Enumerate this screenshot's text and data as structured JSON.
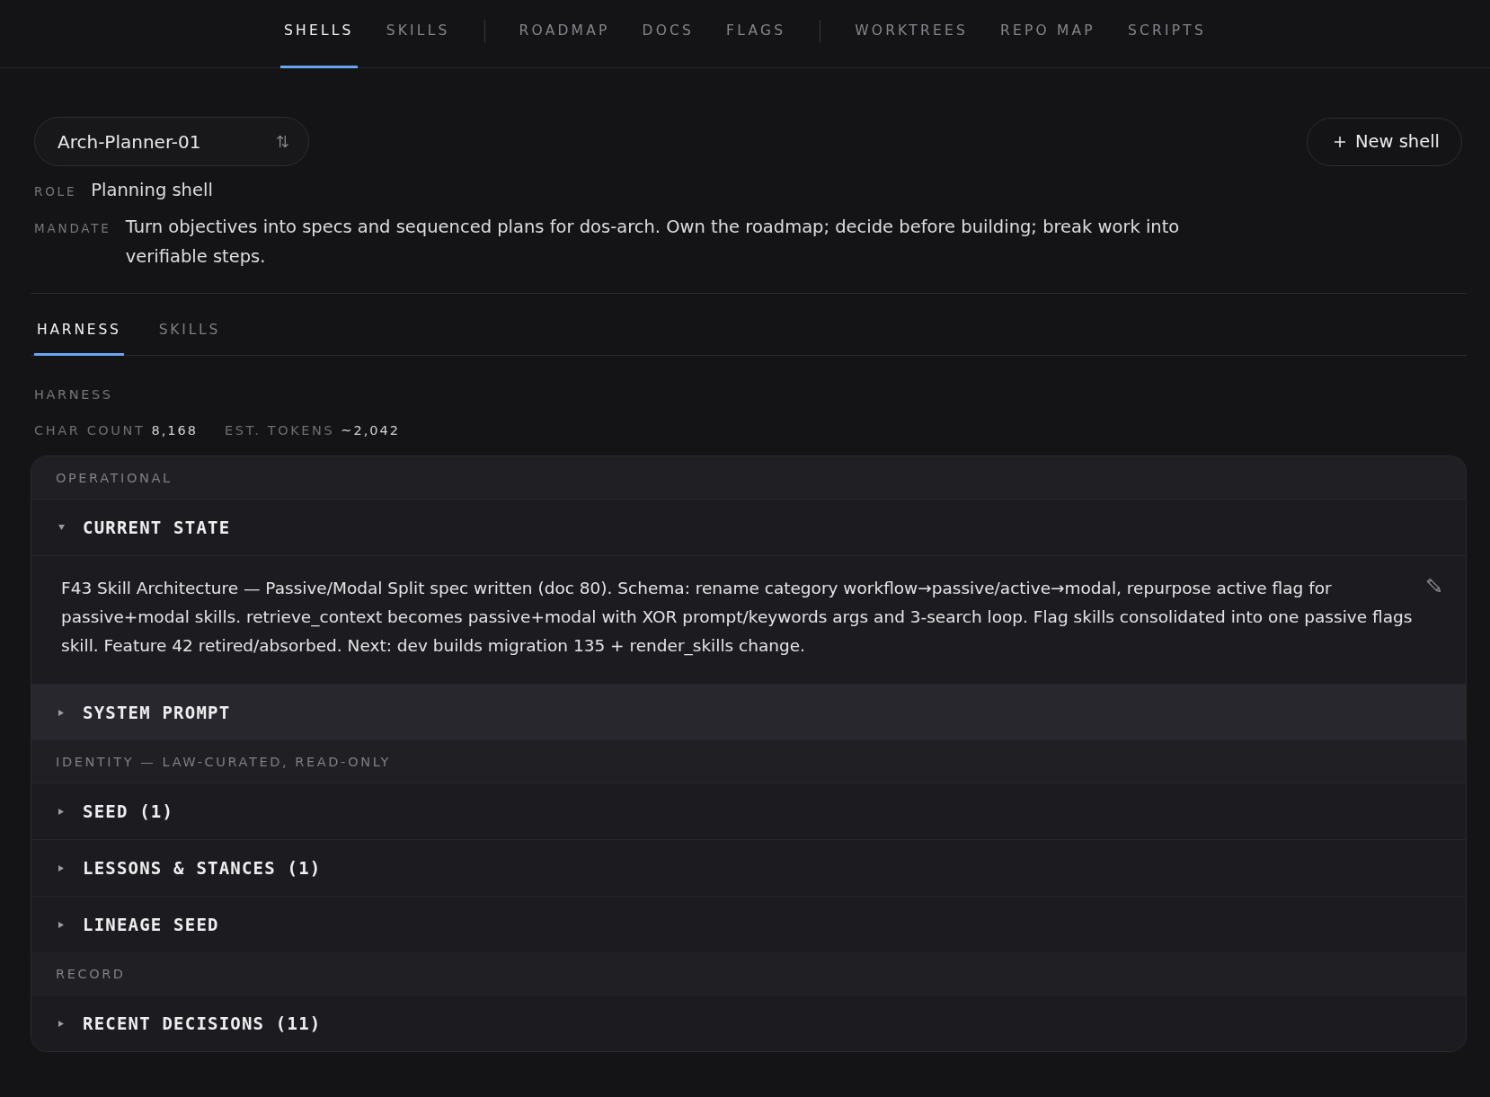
{
  "nav": {
    "groups": [
      {
        "items": [
          {
            "label": "SHELLS",
            "selected": true
          },
          {
            "label": "SKILLS",
            "selected": false
          }
        ]
      },
      {
        "items": [
          {
            "label": "ROADMAP",
            "selected": false
          },
          {
            "label": "DOCS",
            "selected": false
          },
          {
            "label": "FLAGS",
            "selected": false
          }
        ]
      },
      {
        "items": [
          {
            "label": "WORKTREES",
            "selected": false
          },
          {
            "label": "REPO MAP",
            "selected": false
          },
          {
            "label": "SCRIPTS",
            "selected": false
          }
        ]
      }
    ]
  },
  "shell_selector": {
    "value": "Arch-Planner-01"
  },
  "new_shell_button": {
    "label": "New shell"
  },
  "role": {
    "label": "ROLE",
    "value": "Planning shell"
  },
  "mandate": {
    "label": "MANDATE",
    "value": "Turn objectives into specs and sequenced plans for dos-arch. Own the roadmap; decide before building; break work into verifiable steps."
  },
  "tabs": [
    {
      "label": "HARNESS",
      "selected": true
    },
    {
      "label": "SKILLS",
      "selected": false
    }
  ],
  "harness": {
    "title": "HARNESS",
    "stats": [
      {
        "label": "CHAR COUNT",
        "value": "8,168"
      },
      {
        "label": "EST. TOKENS",
        "value": "~2,042"
      }
    ],
    "sections": [
      {
        "title": "OPERATIONAL",
        "items": [
          {
            "title": "CURRENT STATE",
            "expanded": true,
            "highlighted": false,
            "body": "F43 Skill Architecture — Passive/Modal Split spec written (doc 80). Schema: rename category workflow→passive/active→modal, repurpose active flag for passive+modal skills. retrieve_context becomes passive+modal with XOR prompt/keywords args and 3-search loop. Flag skills consolidated into one passive flags skill. Feature 42 retired/absorbed. Next: dev builds migration 135 + render_skills change."
          },
          {
            "title": "SYSTEM PROMPT",
            "expanded": false,
            "highlighted": true
          }
        ]
      },
      {
        "title": "IDENTITY — LAW-CURATED, READ-ONLY",
        "items": [
          {
            "title": "SEED (1)",
            "expanded": false,
            "highlighted": false
          },
          {
            "title": "LESSONS & STANCES (1)",
            "expanded": false,
            "highlighted": false
          },
          {
            "title": "LINEAGE SEED",
            "expanded": false,
            "highlighted": false
          }
        ]
      },
      {
        "title": "RECORD",
        "items": [
          {
            "title": "RECENT DECISIONS (11)",
            "expanded": false,
            "highlighted": false
          }
        ]
      }
    ]
  }
}
